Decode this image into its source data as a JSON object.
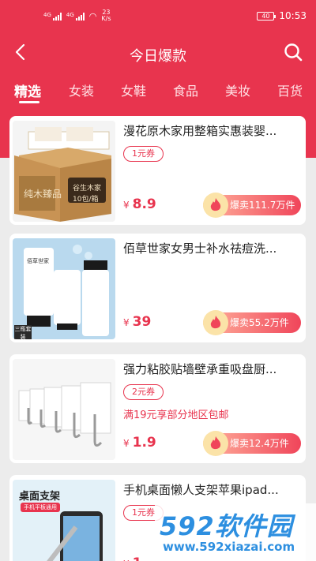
{
  "status": {
    "network1": "4G",
    "network2": "4G",
    "speed": "23",
    "speed_unit": "K/s",
    "battery": "40",
    "time": "10:53"
  },
  "nav": {
    "title": "今日爆款",
    "back_icon": "chevron-left-icon",
    "search_icon": "search-icon"
  },
  "tabs": [
    "精选",
    "女装",
    "女鞋",
    "食品",
    "美妆",
    "百货"
  ],
  "active_tab": 0,
  "colors": {
    "accent": "#e8344e",
    "background": "#ececec"
  },
  "products": [
    {
      "name": "漫花原木家用整箱实惠装婴...",
      "coupon": "1元券",
      "promo": "",
      "currency": "¥",
      "price": "8.9",
      "sold": "爆卖111.7万件",
      "image_texts": [
        "纯木臻品",
        "谷生木家",
        "10包/箱"
      ]
    },
    {
      "name": "佰草世家女男士补水祛痘洗...",
      "coupon": "",
      "promo": "",
      "currency": "¥",
      "price": "39",
      "sold": "爆卖55.2万件",
      "image_texts": [
        "佰草世家",
        "三瓶套装"
      ]
    },
    {
      "name": "强力粘胶贴墙壁承重吸盘厨...",
      "coupon": "2元券",
      "promo": "满19元享部分地区包邮",
      "currency": "¥",
      "price": "1.9",
      "sold": "爆卖12.4万件",
      "image_texts": []
    },
    {
      "name": "手机桌面懒人支架苹果ipad...",
      "coupon": "1元券",
      "promo": "",
      "currency": "¥",
      "price": "1.",
      "sold": "",
      "image_texts": [
        "桌面支架",
        "手机平板通用"
      ]
    }
  ],
  "watermark": {
    "big": "592软件园",
    "url": "www.592xiazai.com"
  }
}
